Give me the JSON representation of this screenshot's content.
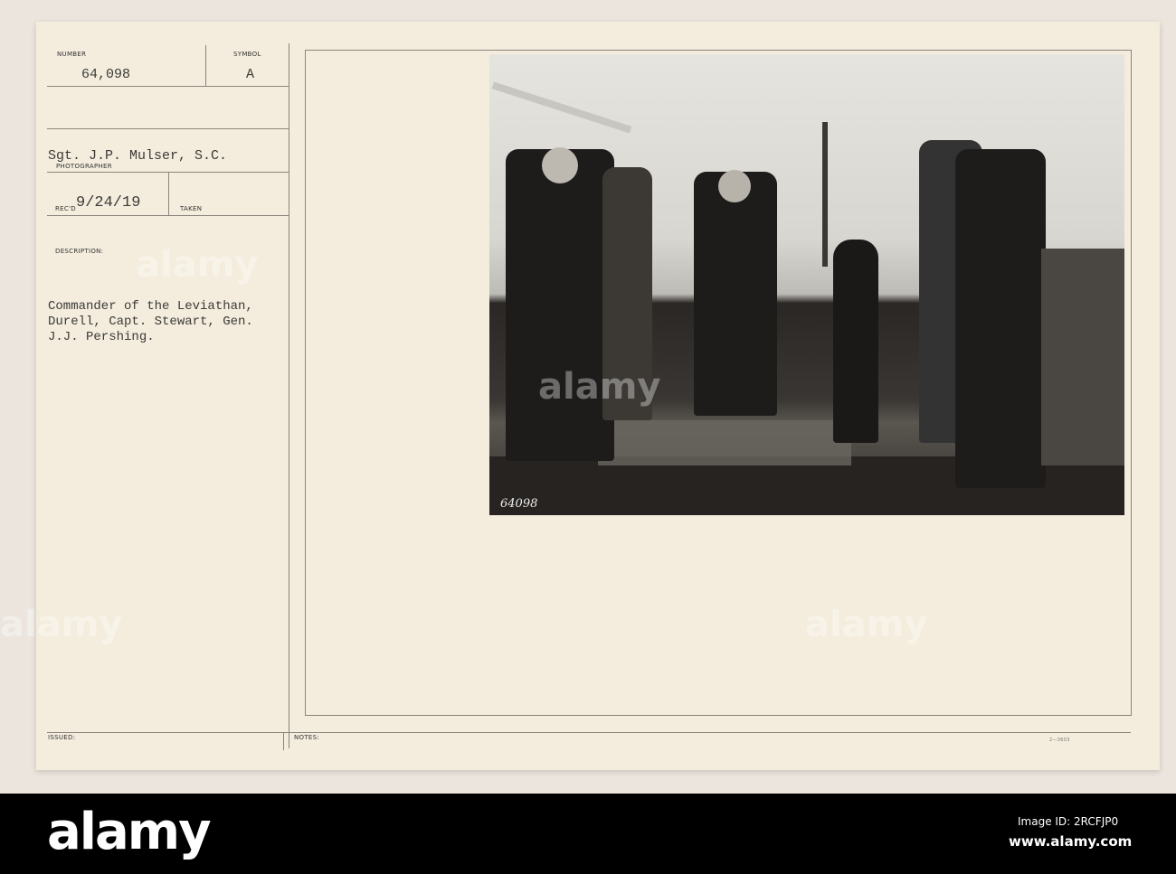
{
  "card": {
    "number_label": "NUMBER",
    "number": "64,098",
    "symbol_label": "SYMBOL",
    "symbol": "A",
    "photographer": "Sgt. J.P. Mulser, S.C.",
    "photographer_label": "PHOTOGRAPHER",
    "recd_label": "REC'D",
    "recd_date": "9/24/19",
    "taken_label": "TAKEN",
    "description_label": "DESCRIPTION:",
    "description_lines": [
      "Commander of the Leviathan,",
      "Durell, Capt. Stewart, Gen.",
      "J.J. Pershing."
    ],
    "issued_label": "ISSUED:",
    "notes_label": "NOTES:",
    "form_number": "2—3603"
  },
  "photo": {
    "negative_number": "64098"
  },
  "footer": {
    "logo": "alamy",
    "image_id": "Image ID: 2RCFJP0",
    "site": "www.alamy.com",
    "watermark": "alamy"
  }
}
